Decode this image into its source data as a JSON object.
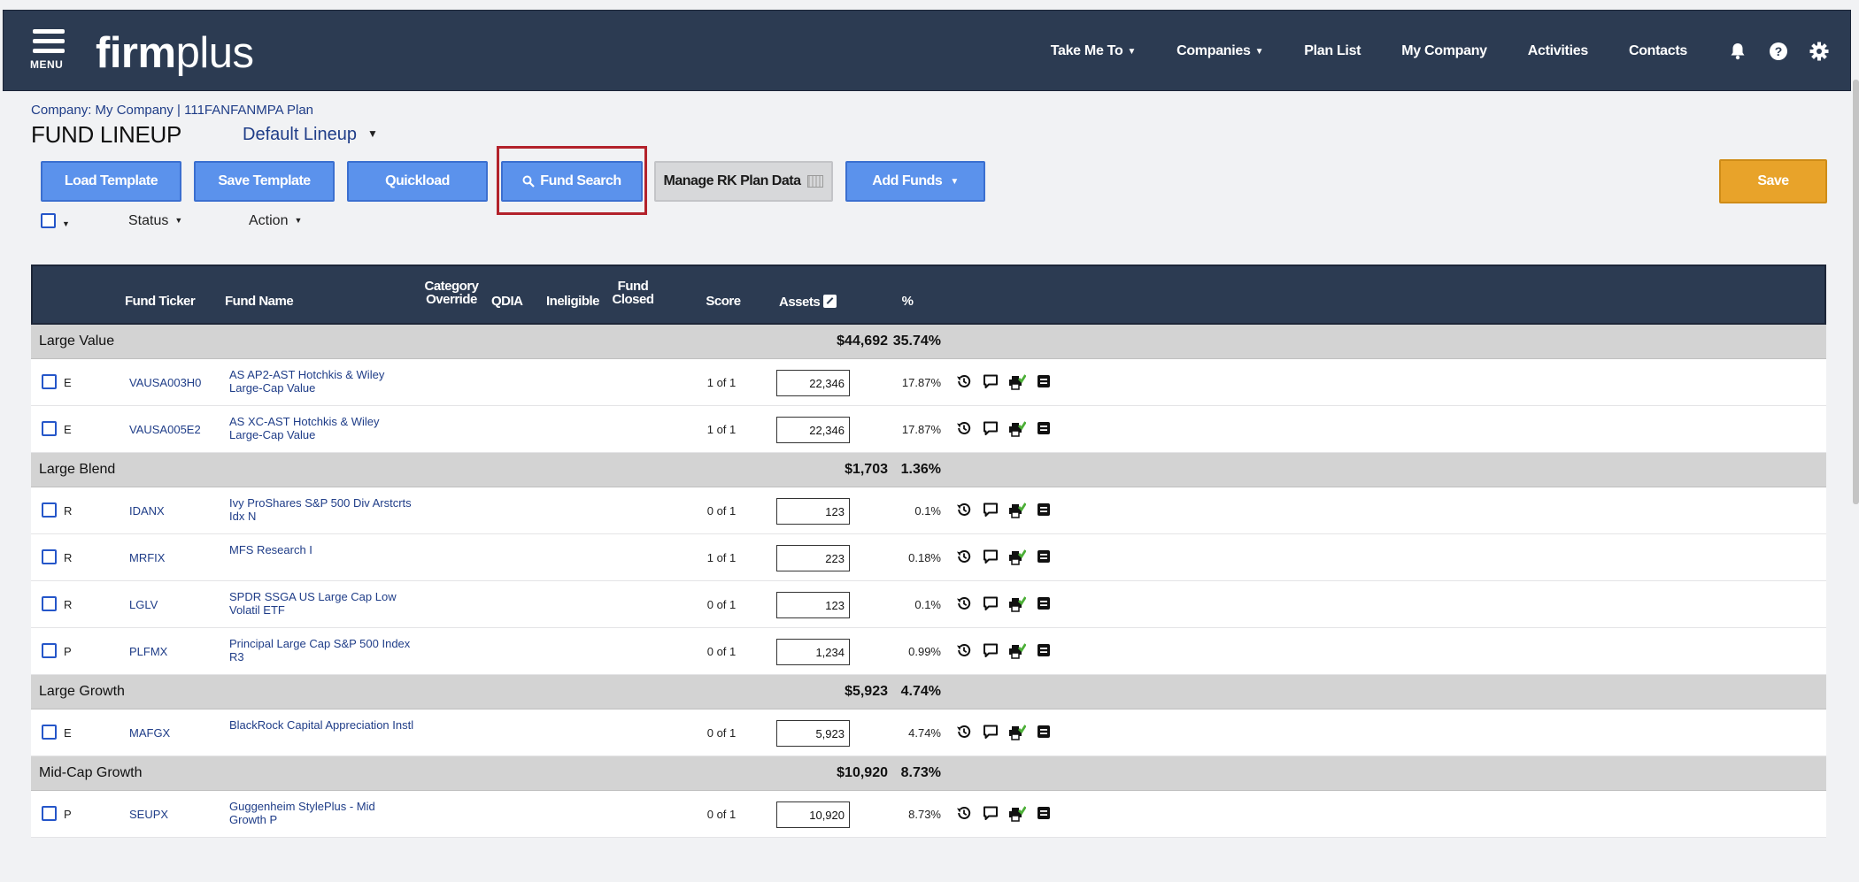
{
  "header": {
    "menu_label": "MENU",
    "logo_bold": "firm",
    "logo_light": "plus",
    "nav": [
      {
        "label": "Take Me To",
        "dropdown": true
      },
      {
        "label": "Companies",
        "dropdown": true
      },
      {
        "label": "Plan List",
        "dropdown": false
      },
      {
        "label": "My Company",
        "dropdown": false
      },
      {
        "label": "Activities",
        "dropdown": false
      },
      {
        "label": "Contacts",
        "dropdown": false
      }
    ],
    "icons": [
      "bell-icon",
      "help-icon",
      "gear-icon"
    ]
  },
  "page": {
    "breadcrumb": "Company: My Company | 111FANFANMPA Plan",
    "title": "FUND LINEUP",
    "lineup": "Default Lineup"
  },
  "toolbar": {
    "load_template": "Load Template",
    "save_template": "Save Template",
    "quickload": "Quickload",
    "fund_search": "Fund Search",
    "manage_rk": "Manage RK Plan Data",
    "add_funds": "Add Funds",
    "save": "Save"
  },
  "filters": {
    "status": "Status",
    "action": "Action"
  },
  "table": {
    "headers": {
      "ticker": "Fund Ticker",
      "name": "Fund Name",
      "category_1": "Category",
      "category_2": "Override",
      "qdia": "QDIA",
      "ineligible": "Ineligible",
      "closed_1": "Fund",
      "closed_2": "Closed",
      "score": "Score",
      "assets": "Assets",
      "pct": "%"
    },
    "groups": [
      {
        "name": "Large Value",
        "assets": "$44,692",
        "pct": "35.74%",
        "funds": [
          {
            "share": "E",
            "ticker": "VAUSA003H0",
            "name": "AS AP2-AST Hotchkis & Wiley Large-Cap Value",
            "score": "1 of 1",
            "assets": "22,346",
            "pct": "17.87%"
          },
          {
            "share": "E",
            "ticker": "VAUSA005E2",
            "name": "AS XC-AST Hotchkis & Wiley Large-Cap Value",
            "score": "1 of 1",
            "assets": "22,346",
            "pct": "17.87%"
          }
        ]
      },
      {
        "name": "Large Blend",
        "assets": "$1,703",
        "pct": "1.36%",
        "funds": [
          {
            "share": "R",
            "ticker": "IDANX",
            "name": "Ivy ProShares S&P 500 Div Arstcrts Idx N",
            "score": "0 of 1",
            "assets": "123",
            "pct": "0.1%"
          },
          {
            "share": "R",
            "ticker": "MRFIX",
            "name": "MFS Research I",
            "score": "1 of 1",
            "assets": "223",
            "pct": "0.18%"
          },
          {
            "share": "R",
            "ticker": "LGLV",
            "name": "SPDR SSGA US Large Cap Low Volatil ETF",
            "score": "0 of 1",
            "assets": "123",
            "pct": "0.1%"
          },
          {
            "share": "P",
            "ticker": "PLFMX",
            "name": "Principal Large Cap S&P 500 Index R3",
            "score": "0 of 1",
            "assets": "1,234",
            "pct": "0.99%"
          }
        ]
      },
      {
        "name": "Large Growth",
        "assets": "$5,923",
        "pct": "4.74%",
        "funds": [
          {
            "share": "E",
            "ticker": "MAFGX",
            "name": "BlackRock Capital Appreciation Instl",
            "score": "0 of 1",
            "assets": "5,923",
            "pct": "4.74%"
          }
        ]
      },
      {
        "name": "Mid-Cap Growth",
        "assets": "$10,920",
        "pct": "8.73%",
        "funds": [
          {
            "share": "P",
            "ticker": "SEUPX",
            "name": "Guggenheim StylePlus - Mid Growth P",
            "score": "0 of 1",
            "assets": "10,920",
            "pct": "8.73%"
          }
        ]
      }
    ]
  },
  "colors": {
    "navbar": "#2c3b52",
    "button_blue": "#5b92ec",
    "save_orange": "#e8a32a",
    "link_blue": "#1f3d88",
    "highlight_red": "#b3222b",
    "row_action_green": "#4caf37"
  }
}
